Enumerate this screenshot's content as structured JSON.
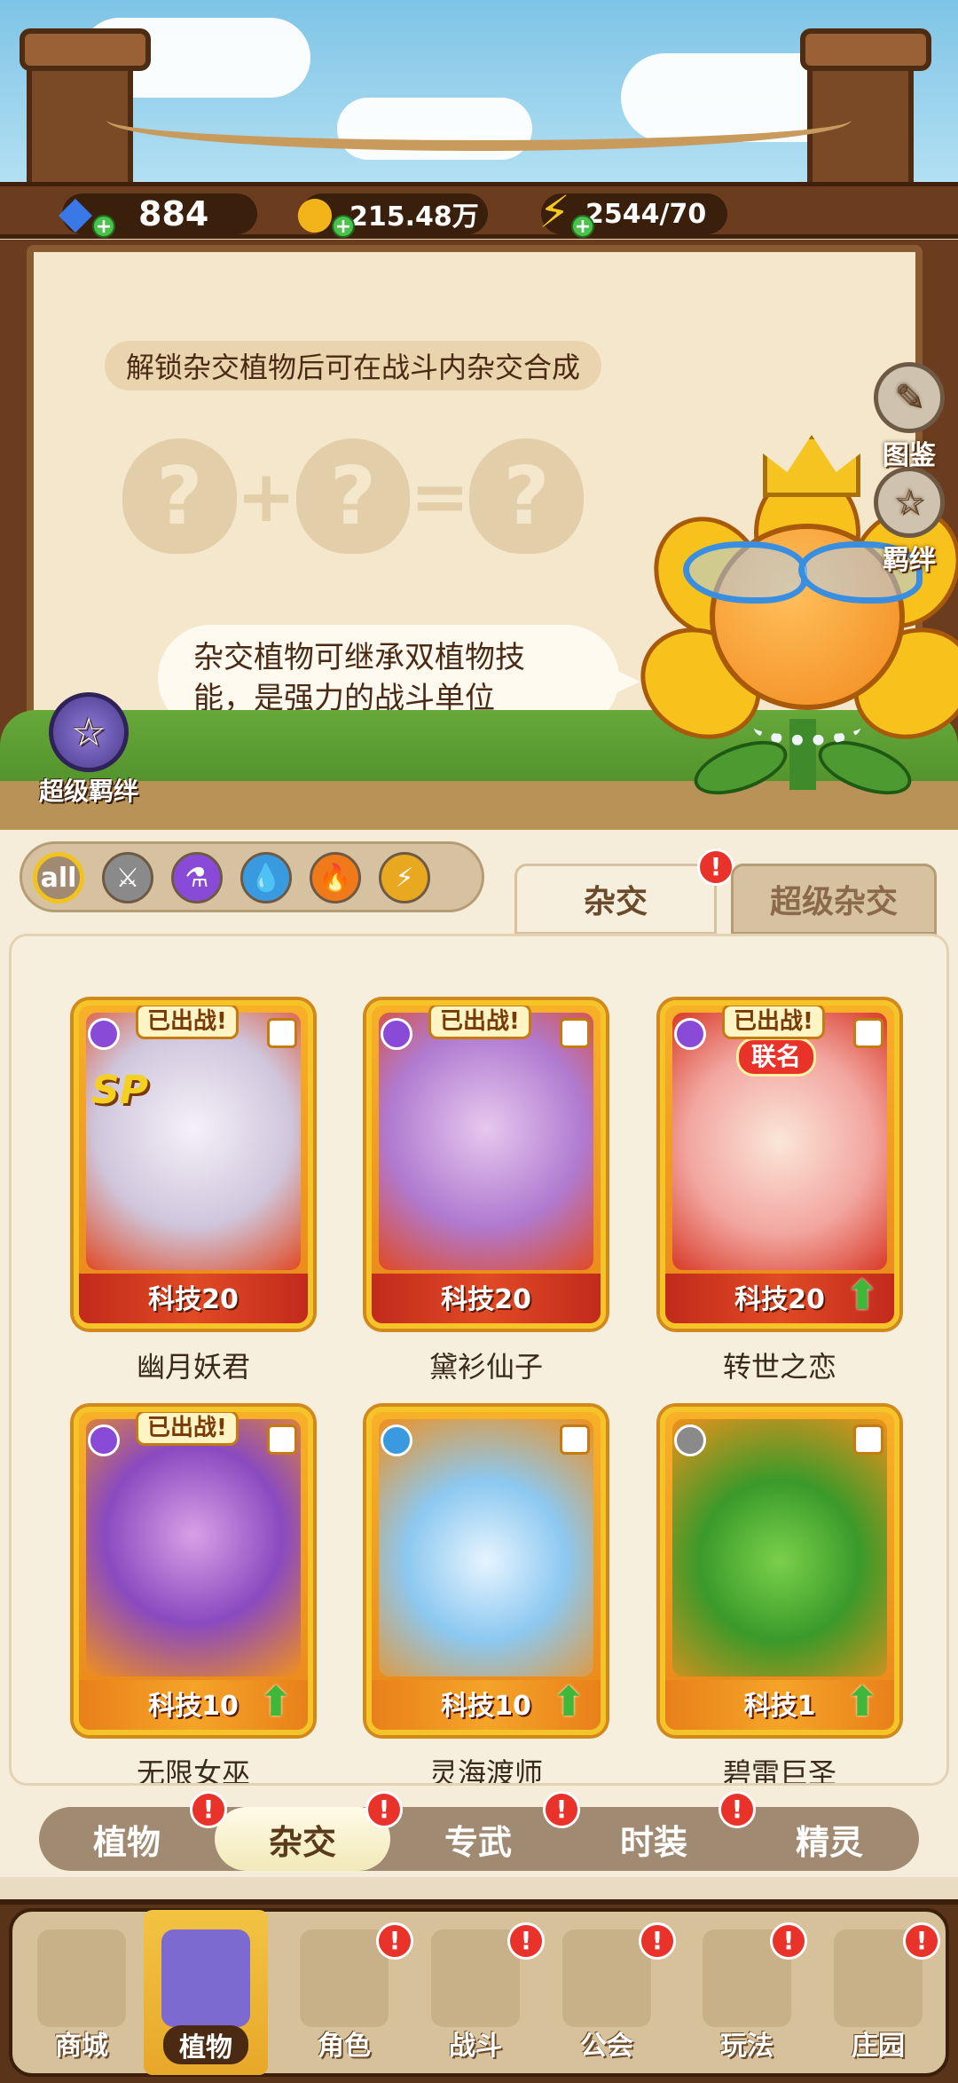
{
  "resources": {
    "gems": "884",
    "coins": "215.48万",
    "energy": "2544/70"
  },
  "board": {
    "banner": "解锁杂交植物后可在战斗内杂交合成",
    "formula_symbol": "?",
    "plus": "+",
    "equals": "=",
    "bubble": "杂交植物可继承双植物技能，是强力的战斗单位"
  },
  "side_buttons": {
    "codex": "图鉴",
    "bond": "羁绊",
    "super_bond": "超级羁绊"
  },
  "filters": {
    "all_label": "all",
    "items": [
      "all",
      "sword",
      "potion",
      "water",
      "fire",
      "lightning"
    ]
  },
  "tabs": {
    "hybrid": "杂交",
    "super_hybrid": "超级杂交",
    "badge": "!"
  },
  "cards": [
    {
      "name": "幽月妖君",
      "level": "科技20",
      "deployed": "已出战!",
      "sp": "SP",
      "collab": "",
      "upgrade": false
    },
    {
      "name": "黛衫仙子",
      "level": "科技20",
      "deployed": "已出战!",
      "sp": "",
      "collab": "",
      "upgrade": false
    },
    {
      "name": "转世之恋",
      "level": "科技20",
      "deployed": "已出战!",
      "sp": "",
      "collab": "联名",
      "upgrade": true
    },
    {
      "name": "无限女巫",
      "level": "科技10",
      "deployed": "已出战!",
      "sp": "",
      "collab": "",
      "upgrade": true
    },
    {
      "name": "灵海渡师",
      "level": "科技10",
      "deployed": "",
      "sp": "",
      "collab": "",
      "upgrade": true
    },
    {
      "name": "碧雷巨圣",
      "level": "科技1",
      "deployed": "",
      "sp": "",
      "collab": "",
      "upgrade": true
    }
  ],
  "sub_tabs": [
    "植物",
    "杂交",
    "专武",
    "时装",
    "精灵"
  ],
  "nav": [
    "商城",
    "植物",
    "角色",
    "战斗",
    "公会",
    "玩法",
    "庄园"
  ],
  "colors": {
    "wood": "#6b3d1e",
    "board": "#f4e7cb",
    "card_gold": "#f5c428",
    "badge_red": "#e8322a"
  }
}
